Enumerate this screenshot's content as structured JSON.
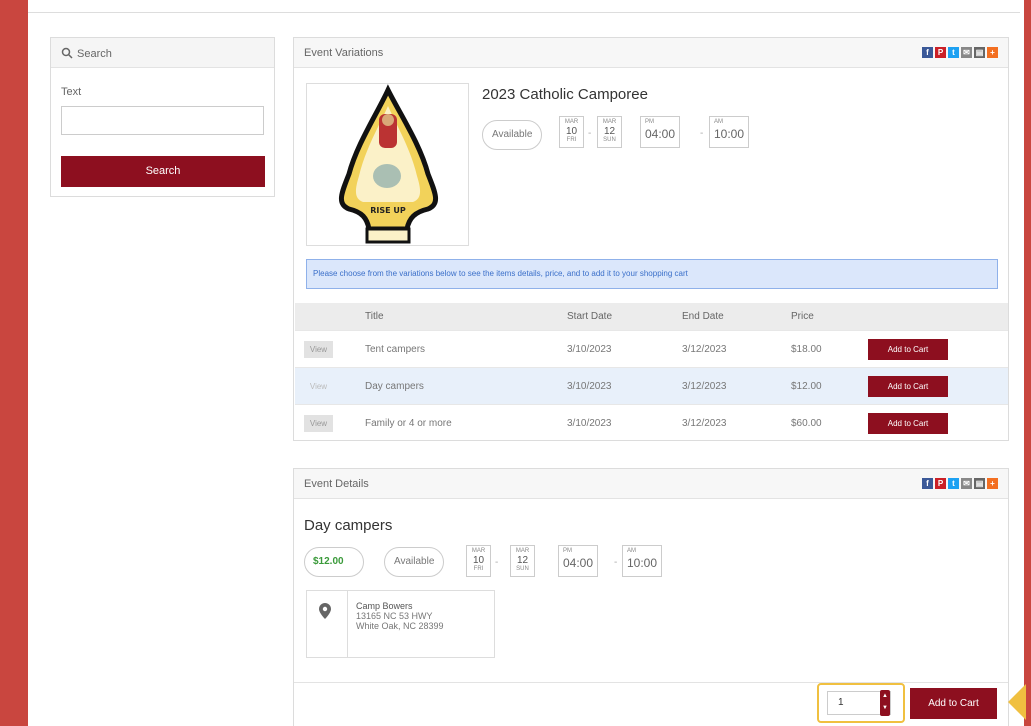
{
  "colors": {
    "brand_red": "#8d0f1f",
    "side_bar": "#c9463f",
    "price_green": "#3a9a3a",
    "notice_blue": "#3a6fc9",
    "highlight_yellow": "#f0c040"
  },
  "search": {
    "title": "Search",
    "text_label": "Text",
    "text_value": "",
    "button_label": "Search"
  },
  "variations": {
    "panel_title": "Event Variations",
    "share_icons": [
      "facebook-icon",
      "pinterest-icon",
      "twitter-icon",
      "email-icon",
      "print-icon",
      "plus-icon"
    ],
    "event_title": "2023 Catholic Camporee",
    "status": "Available",
    "start": {
      "month": "MAR",
      "day": "10",
      "weekday": "FRI"
    },
    "end": {
      "month": "MAR",
      "day": "12",
      "weekday": "SUN"
    },
    "start_time": {
      "label": "PM",
      "time": "04:00"
    },
    "end_time": {
      "label": "AM",
      "time": "10:00"
    },
    "image_caption": "RISE UP",
    "notice": "Please choose from the variations below to see the items details, price, and to add it to your shopping cart",
    "columns": [
      "Title",
      "Start Date",
      "End Date",
      "Price"
    ],
    "rows": [
      {
        "view": "View",
        "title": "Tent campers",
        "start": "3/10/2023",
        "end": "3/12/2023",
        "price": "$18.00",
        "cart": "Add to Cart"
      },
      {
        "view": "View",
        "title": "Day campers",
        "start": "3/10/2023",
        "end": "3/12/2023",
        "price": "$12.00",
        "cart": "Add to Cart"
      },
      {
        "view": "View",
        "title": "Family or 4 or more",
        "start": "3/10/2023",
        "end": "3/12/2023",
        "price": "$60.00",
        "cart": "Add to Cart"
      }
    ]
  },
  "details": {
    "panel_title": "Event Details",
    "title": "Day campers",
    "price": "$12.00",
    "status": "Available",
    "start": {
      "month": "MAR",
      "day": "10",
      "weekday": "FRI"
    },
    "end": {
      "month": "MAR",
      "day": "12",
      "weekday": "SUN"
    },
    "start_time": {
      "label": "PM",
      "time": "04:00"
    },
    "end_time": {
      "label": "AM",
      "time": "10:00"
    },
    "location": {
      "name": "Camp Bowers",
      "address1": "13165 NC 53 HWY",
      "address2": "White Oak, NC 28399"
    },
    "quantity": "1",
    "add_to_cart": "Add to Cart"
  }
}
